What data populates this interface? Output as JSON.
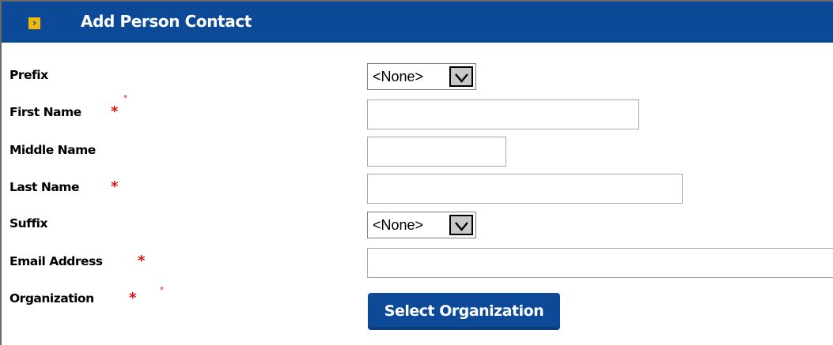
{
  "header": {
    "icon": "›",
    "title": "Add Person Contact"
  },
  "form": {
    "prefix_label": "Prefix",
    "prefix_value": "<None>",
    "first_name_label": "First Name",
    "middle_name_label": "Middle Name",
    "last_name_label": "Last Name",
    "suffix_label": "Suffix",
    "suffix_value": "<None>",
    "email_label": "Email Address",
    "organization_label": "Organization",
    "required_marker": "*",
    "select_org_button": "Select Organization"
  },
  "colors": {
    "header_bg": "#0c4a98",
    "header_icon": "#f0b70c",
    "required": "#e20e0e",
    "button_bg": "#0c4a98"
  }
}
